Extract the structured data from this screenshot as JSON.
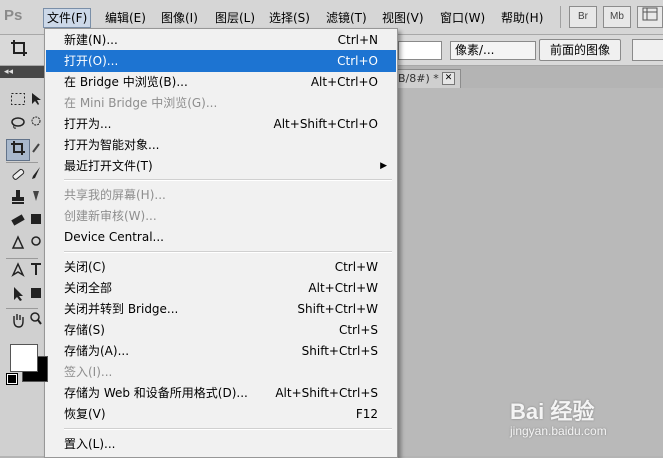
{
  "app": {
    "logo": "Ps",
    "menubar": [
      "文件(F)",
      "编辑(E)",
      "图像(I)",
      "图层(L)",
      "选择(S)",
      "滤镜(T)",
      "视图(V)",
      "窗口(W)",
      "帮助(H)"
    ],
    "top_icons": [
      "Br",
      "Mb"
    ]
  },
  "options_bar": {
    "unit_select": "像素/...",
    "front_image_button": "前面的图像"
  },
  "document": {
    "tab_label": "B/8#) *",
    "close_glyph": "✕"
  },
  "tools": {
    "panel_grip": "◂◂"
  },
  "file_menu": {
    "items": [
      {
        "label": "新建(N)...",
        "shortcut": "Ctrl+N"
      },
      {
        "label": "打开(O)...",
        "shortcut": "Ctrl+O"
      },
      {
        "label": "在 Bridge 中浏览(B)...",
        "shortcut": "Alt+Ctrl+O"
      },
      {
        "label": "在 Mini Bridge 中浏览(G)...",
        "shortcut": ""
      },
      {
        "label": "打开为...",
        "shortcut": "Alt+Shift+Ctrl+O"
      },
      {
        "label": "打开为智能对象...",
        "shortcut": ""
      },
      {
        "label": "最近打开文件(T)",
        "shortcut": ""
      },
      {
        "label": "共享我的屏幕(H)...",
        "shortcut": ""
      },
      {
        "label": "创建新审核(W)...",
        "shortcut": ""
      },
      {
        "label": "Device Central...",
        "shortcut": ""
      },
      {
        "label": "关闭(C)",
        "shortcut": "Ctrl+W"
      },
      {
        "label": "关闭全部",
        "shortcut": "Alt+Ctrl+W"
      },
      {
        "label": "关闭并转到 Bridge...",
        "shortcut": "Shift+Ctrl+W"
      },
      {
        "label": "存储(S)",
        "shortcut": "Ctrl+S"
      },
      {
        "label": "存储为(A)...",
        "shortcut": "Shift+Ctrl+S"
      },
      {
        "label": "签入(I)...",
        "shortcut": ""
      },
      {
        "label": "存储为 Web 和设备所用格式(D)...",
        "shortcut": "Alt+Shift+Ctrl+S"
      },
      {
        "label": "恢复(V)",
        "shortcut": "F12"
      },
      {
        "label": "置入(L)...",
        "shortcut": ""
      }
    ],
    "submenu_arrow": "▶"
  },
  "watermark": {
    "logo": "Bai 经验",
    "url": "jingyan.baidu.com"
  },
  "colors": {
    "highlight": "#1d74d2",
    "disabled_text": "#8e8e8e",
    "menu_bg": "#f1f1f1"
  }
}
